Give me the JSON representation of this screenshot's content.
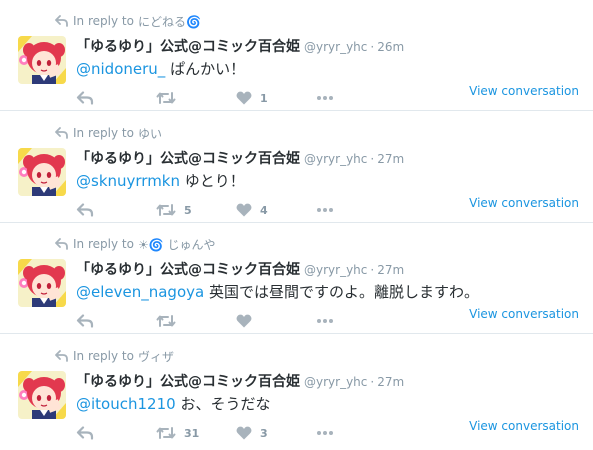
{
  "tweets": [
    {
      "reply_prefix": "In reply to",
      "reply_user": "にどねる🌀",
      "display_name": "「ゆるゆり」公式@コミック百合姫",
      "handle": "@yryr_yhc",
      "dot": "·",
      "time": "26m",
      "mention": "@nidoneru_",
      "text": " ぱんかい！",
      "retweets": "",
      "likes": "1",
      "view_label": "View conversation"
    },
    {
      "reply_prefix": "In reply to",
      "reply_user": "ゆい",
      "display_name": "「ゆるゆり」公式@コミック百合姫",
      "handle": "@yryr_yhc",
      "dot": "·",
      "time": "27m",
      "mention": "@sknuyrrmkn",
      "text": " ゆとり！",
      "retweets": "5",
      "likes": "4",
      "view_label": "View conversation"
    },
    {
      "reply_prefix": "In reply to",
      "reply_user": "☀🌀 じゅんや",
      "display_name": "「ゆるゆり」公式@コミック百合姫",
      "handle": "@yryr_yhc",
      "dot": "·",
      "time": "27m",
      "mention": "@eleven_nagoya",
      "text": " 英国では昼間ですのよ。離脱しますわ。",
      "retweets": "",
      "likes": "",
      "view_label": "View conversation"
    },
    {
      "reply_prefix": "In reply to",
      "reply_user": "ヴィザ",
      "display_name": "「ゆるゆり」公式@コミック百合姫",
      "handle": "@yryr_yhc",
      "dot": "·",
      "time": "27m",
      "mention": "@itouch1210",
      "text": " お、そうだな",
      "retweets": "31",
      "likes": "3",
      "view_label": "View conversation"
    }
  ],
  "icons": {
    "reply": "reply-arrow-icon",
    "retweet": "retweet-icon",
    "like": "heart-icon",
    "more": "more-dots-icon"
  },
  "colors": {
    "link": "#1b95e0",
    "muted": "#8899a6",
    "icon": "#a8b3bc",
    "text": "#292f33",
    "border": "#e1e8ed"
  }
}
